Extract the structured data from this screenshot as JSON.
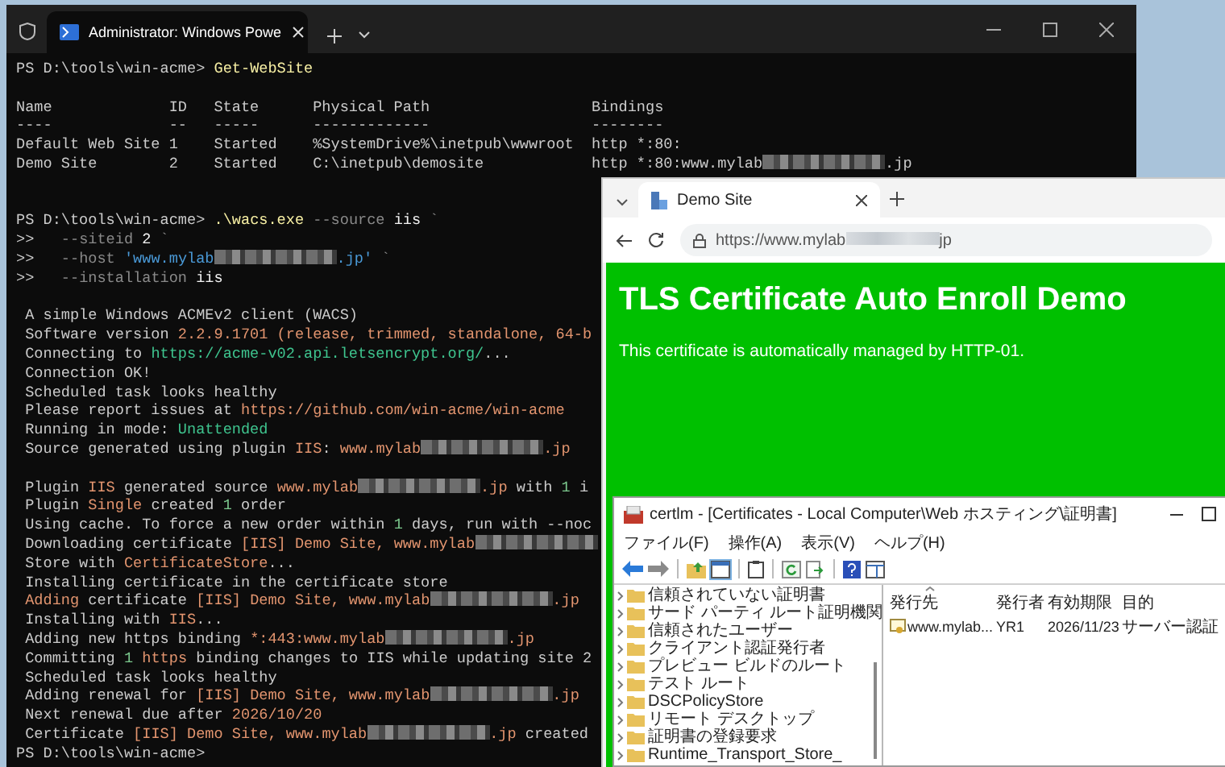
{
  "terminal": {
    "tab_title": "Administrator: Windows Powe",
    "lines": [
      {
        "kind": "prompt",
        "segments": [
          {
            "text": "PS D:\\tools\\win-acme> ",
            "kind": "plain"
          },
          {
            "text": "Get-WebSite",
            "kind": "command"
          }
        ]
      },
      {
        "kind": "blank"
      },
      {
        "kind": "table",
        "columns": [
          {
            "label": "Name",
            "rule": "----"
          },
          {
            "label": "ID",
            "rule": "--"
          },
          {
            "label": "State",
            "rule": "-----"
          },
          {
            "label": "Physical Path",
            "rule": "-------------"
          },
          {
            "label": "Bindings",
            "rule": "--------"
          }
        ],
        "rows": [
          {
            "name": "Default Web Site",
            "id": "1",
            "state": "Started",
            "path": "%SystemDrive%\\inetpub\\wwwroot",
            "binding": [
              {
                "text": "http *:80:",
                "kind": "plain"
              }
            ]
          },
          {
            "name": "Demo Site",
            "id": "2",
            "state": "Started",
            "path": "C:\\inetpub\\demosite",
            "binding": [
              {
                "text": "http *:80:www.mylab",
                "kind": "plain"
              },
              {
                "kind": "redacted"
              },
              {
                "text": ".jp",
                "kind": "plain"
              }
            ]
          }
        ]
      },
      {
        "kind": "blank"
      },
      {
        "kind": "blank"
      },
      {
        "kind": "prompt",
        "segments": [
          {
            "text": "PS D:\\tools\\win-acme> ",
            "kind": "plain"
          },
          {
            "text": ".\\wacs.exe",
            "kind": "command"
          },
          {
            "text": " --source",
            "kind": "muted"
          },
          {
            "text": " iis",
            "kind": "bright"
          },
          {
            "text": " `",
            "kind": "muted"
          }
        ]
      },
      {
        "kind": "prompt",
        "segments": [
          {
            "text": ">>   ",
            "kind": "plain"
          },
          {
            "text": "--siteid",
            "kind": "muted"
          },
          {
            "text": " 2",
            "kind": "bright"
          },
          {
            "text": " `",
            "kind": "muted"
          }
        ]
      },
      {
        "kind": "prompt",
        "segments": [
          {
            "text": ">>   ",
            "kind": "plain"
          },
          {
            "text": "--host",
            "kind": "muted"
          },
          {
            "text": " 'www.mylab",
            "kind": "string"
          },
          {
            "kind": "redacted"
          },
          {
            "text": ".jp'",
            "kind": "string"
          },
          {
            "text": " `",
            "kind": "muted"
          }
        ]
      },
      {
        "kind": "prompt",
        "segments": [
          {
            "text": ">>   ",
            "kind": "plain"
          },
          {
            "text": "--installation",
            "kind": "muted"
          },
          {
            "text": " iis",
            "kind": "bright"
          }
        ]
      },
      {
        "kind": "blank"
      },
      {
        "kind": "output",
        "segments": [
          {
            "text": "A simple Windows ACMEv2 client (WACS)",
            "kind": "plain"
          }
        ]
      },
      {
        "kind": "output",
        "segments": [
          {
            "text": "Software version ",
            "kind": "plain"
          },
          {
            "text": "2.2.9.1701",
            "kind": "value"
          },
          {
            "text": " (release, trimmed, standalone, 64-b",
            "kind": "value"
          }
        ]
      },
      {
        "kind": "output",
        "segments": [
          {
            "text": "Connecting to ",
            "kind": "plain"
          },
          {
            "text": "https://acme-v02.api.letsencrypt.org/",
            "kind": "link"
          },
          {
            "text": "...",
            "kind": "plain"
          }
        ]
      },
      {
        "kind": "output",
        "segments": [
          {
            "text": "Connection OK!",
            "kind": "plain"
          }
        ]
      },
      {
        "kind": "output",
        "segments": [
          {
            "text": "Scheduled task looks healthy",
            "kind": "plain"
          }
        ]
      },
      {
        "kind": "output",
        "segments": [
          {
            "text": "Please report issues at ",
            "kind": "plain"
          },
          {
            "text": "https://github.com/win-acme/win-acme",
            "kind": "value"
          }
        ]
      },
      {
        "kind": "output",
        "segments": [
          {
            "text": "Running in mode: ",
            "kind": "plain"
          },
          {
            "text": "Unattended",
            "kind": "link"
          }
        ]
      },
      {
        "kind": "output",
        "segments": [
          {
            "text": "Source generated using plugin ",
            "kind": "plain"
          },
          {
            "text": "IIS",
            "kind": "value"
          },
          {
            "text": ": ",
            "kind": "plain"
          },
          {
            "text": "www.mylab",
            "kind": "value"
          },
          {
            "kind": "redacted"
          },
          {
            "text": ".jp",
            "kind": "value"
          }
        ]
      },
      {
        "kind": "blank"
      },
      {
        "kind": "output",
        "segments": [
          {
            "text": "Plugin ",
            "kind": "plain"
          },
          {
            "text": "IIS",
            "kind": "value"
          },
          {
            "text": " generated source ",
            "kind": "plain"
          },
          {
            "text": "www.mylab",
            "kind": "value"
          },
          {
            "kind": "redacted"
          },
          {
            "text": ".jp",
            "kind": "value"
          },
          {
            "text": " with ",
            "kind": "plain"
          },
          {
            "text": "1",
            "kind": "number"
          },
          {
            "text": " i",
            "kind": "plain"
          }
        ]
      },
      {
        "kind": "output",
        "segments": [
          {
            "text": "Plugin ",
            "kind": "plain"
          },
          {
            "text": "Single",
            "kind": "value"
          },
          {
            "text": " created ",
            "kind": "plain"
          },
          {
            "text": "1",
            "kind": "number"
          },
          {
            "text": " order",
            "kind": "plain"
          }
        ]
      },
      {
        "kind": "output",
        "segments": [
          {
            "text": "Using cache. To force a new order within ",
            "kind": "plain"
          },
          {
            "text": "1",
            "kind": "number"
          },
          {
            "text": " days, run with --noc",
            "kind": "plain"
          }
        ]
      },
      {
        "kind": "output",
        "segments": [
          {
            "text": "Downloading certificate ",
            "kind": "plain"
          },
          {
            "text": "[IIS] Demo Site, www.mylab",
            "kind": "value"
          },
          {
            "kind": "redacted"
          }
        ]
      },
      {
        "kind": "output",
        "segments": [
          {
            "text": "Store with ",
            "kind": "plain"
          },
          {
            "text": "CertificateStore",
            "kind": "value"
          },
          {
            "text": "...",
            "kind": "plain"
          }
        ]
      },
      {
        "kind": "output",
        "segments": [
          {
            "text": "Installing certificate in the certificate store",
            "kind": "plain"
          }
        ]
      },
      {
        "kind": "output",
        "segments": [
          {
            "text": "Adding",
            "kind": "value"
          },
          {
            "text": " certificate ",
            "kind": "plain"
          },
          {
            "text": "[IIS] Demo Site, www.mylab",
            "kind": "value"
          },
          {
            "kind": "redacted"
          },
          {
            "text": ".jp",
            "kind": "value"
          }
        ]
      },
      {
        "kind": "output",
        "segments": [
          {
            "text": "Installing with ",
            "kind": "plain"
          },
          {
            "text": "IIS",
            "kind": "value"
          },
          {
            "text": "...",
            "kind": "plain"
          }
        ]
      },
      {
        "kind": "output",
        "segments": [
          {
            "text": "Adding new https binding ",
            "kind": "plain"
          },
          {
            "text": "*:443:www.mylab",
            "kind": "value"
          },
          {
            "kind": "redacted"
          },
          {
            "text": ".jp",
            "kind": "value"
          }
        ]
      },
      {
        "kind": "output",
        "segments": [
          {
            "text": "Committing ",
            "kind": "plain"
          },
          {
            "text": "1",
            "kind": "number"
          },
          {
            "text": " https",
            "kind": "value"
          },
          {
            "text": " binding changes to IIS while updating site 2",
            "kind": "plain"
          }
        ]
      },
      {
        "kind": "output",
        "segments": [
          {
            "text": "Scheduled task looks healthy",
            "kind": "plain"
          }
        ]
      },
      {
        "kind": "output",
        "segments": [
          {
            "text": "Adding renewal for ",
            "kind": "plain"
          },
          {
            "text": "[IIS] Demo Site, www.mylab",
            "kind": "value"
          },
          {
            "kind": "redacted"
          },
          {
            "text": ".jp",
            "kind": "value"
          }
        ]
      },
      {
        "kind": "output",
        "segments": [
          {
            "text": "Next renewal due after ",
            "kind": "plain"
          },
          {
            "text": "2026/10/20",
            "kind": "value"
          }
        ]
      },
      {
        "kind": "output",
        "segments": [
          {
            "text": "Certificate ",
            "kind": "plain"
          },
          {
            "text": "[IIS] Demo Site, www.mylab",
            "kind": "value"
          },
          {
            "kind": "redacted"
          },
          {
            "text": ".jp",
            "kind": "value"
          },
          {
            "text": " created",
            "kind": "plain"
          }
        ]
      },
      {
        "kind": "prompt",
        "segments": [
          {
            "text": "PS D:\\tools\\win-acme>",
            "kind": "plain"
          }
        ]
      }
    ]
  },
  "browser": {
    "tab_title": "Demo Site",
    "url_prefix": "https://www.mylab",
    "url_suffix": "jp",
    "page": {
      "heading": "TLS Certificate Auto Enroll Demo",
      "text": "This certificate is automatically managed by HTTP-01."
    }
  },
  "certlm": {
    "title": "certlm - [Certificates - Local Computer\\Web ホスティング\\証明書]",
    "menu": [
      "ファイル(F)",
      "操作(A)",
      "表示(V)",
      "ヘルプ(H)"
    ],
    "tree": [
      "信頼されていない証明書",
      "サード パーティ ルート証明機関",
      "信頼されたユーザー",
      "クライアント認証発行者",
      "プレビュー ビルドのルート",
      "テスト ルート",
      "DSCPolicyStore",
      "リモート デスクトップ",
      "証明書の登録要求",
      "Runtime_Transport_Store_"
    ],
    "columns": [
      "発行先",
      "発行者",
      "有効期限",
      "目的"
    ],
    "rows": [
      {
        "cells": [
          "www.mylab...",
          "YR1",
          "2026/11/23",
          "サーバー認証"
        ]
      }
    ]
  }
}
